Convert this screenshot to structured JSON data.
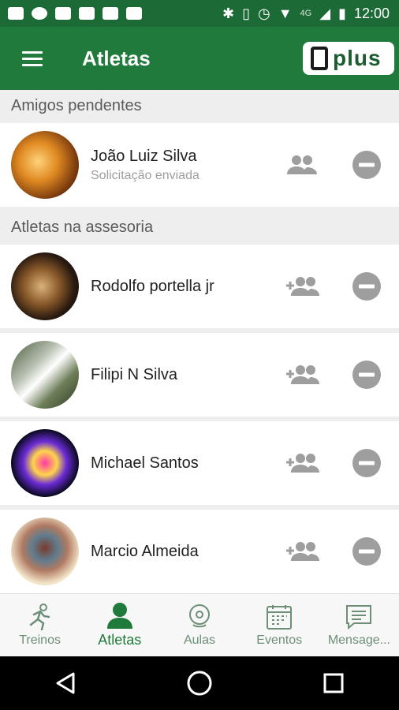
{
  "status": {
    "time": "12:00",
    "network": "4G"
  },
  "appbar": {
    "title": "Atletas",
    "logo_text": "plus"
  },
  "sections": {
    "pending": "Amigos pendentes",
    "advisory": "Atletas na assesoria"
  },
  "pending": [
    {
      "name": "João Luiz Silva",
      "status": "Solicitação enviada"
    }
  ],
  "athletes": [
    {
      "name": "Rodolfo portella jr"
    },
    {
      "name": "Filipi N Silva"
    },
    {
      "name": "Michael Santos"
    },
    {
      "name": "Marcio Almeida"
    }
  ],
  "nav": [
    {
      "label": "Treinos",
      "icon": "runner-icon"
    },
    {
      "label": "Atletas",
      "icon": "person-icon"
    },
    {
      "label": "Aulas",
      "icon": "location-icon"
    },
    {
      "label": "Eventos",
      "icon": "calendar-icon"
    },
    {
      "label": "Mensage...",
      "icon": "message-icon"
    }
  ],
  "colors": {
    "primary": "#1f7a3c",
    "status_bar": "#1c6b36",
    "icon_gray": "#9e9e9e"
  }
}
